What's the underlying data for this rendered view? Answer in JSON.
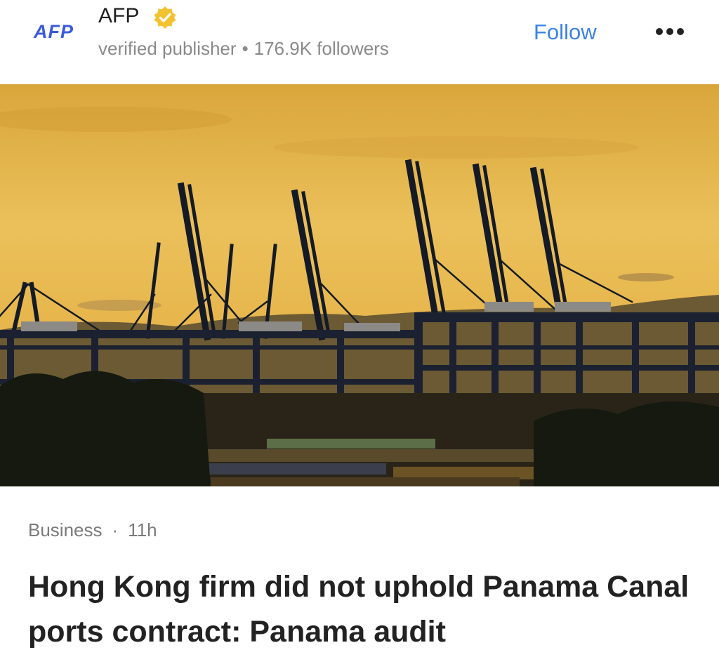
{
  "publisher": {
    "logo_text": "AFP",
    "name": "AFP",
    "badge": "verified-badge-icon",
    "subtitle": "verified publisher",
    "separator": "•",
    "followers": "176.9K followers"
  },
  "actions": {
    "follow_label": "Follow",
    "more_icon": "more-horizontal-icon"
  },
  "hero_image": {
    "subject": "port cranes silhouetted at sunset"
  },
  "article": {
    "category": "Business",
    "separator": "·",
    "time": "11h",
    "headline": "Hong Kong firm did not uphold Panama Canal ports contract: Panama audit"
  },
  "colors": {
    "link": "#3b82e6",
    "logo": "#3b5bdb",
    "badge": "#f2c230",
    "sky": "#e9b84a"
  }
}
